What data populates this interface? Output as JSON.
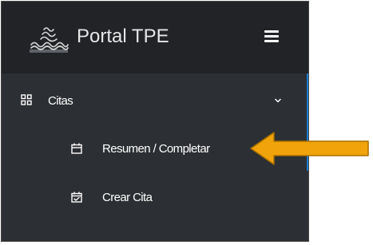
{
  "header": {
    "brand_title": "Portal TPE",
    "logo_icon": "waves-logo-icon",
    "menu_icon": "hamburger-menu-icon"
  },
  "menu": {
    "section": {
      "label": "Citas",
      "icon": "grid-icon",
      "expand_icon": "chevron-down-icon",
      "expanded": true
    },
    "items": [
      {
        "label": "Resumen / Completar",
        "icon": "calendar-icon"
      },
      {
        "label": "Crear Cita",
        "icon": "calendar-check-icon"
      }
    ]
  },
  "annotation": {
    "arrow_icon": "pointer-arrow-icon",
    "color": "#f0a30a"
  },
  "colors": {
    "sidebar_bg": "#2c2f33",
    "header_bg": "#212327",
    "accent": "#1a7bd1",
    "text": "#ffffff"
  }
}
